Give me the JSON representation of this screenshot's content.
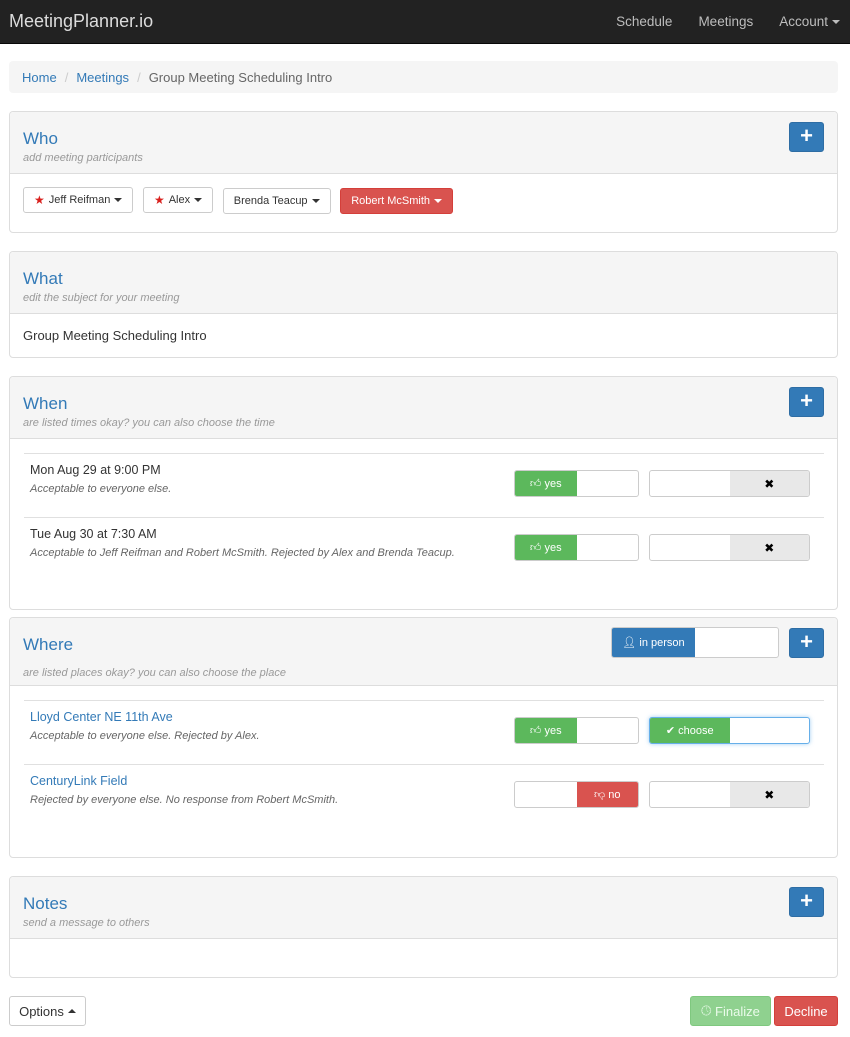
{
  "navbar": {
    "brand": "MeetingPlanner.io",
    "links": [
      "Schedule",
      "Meetings",
      "Account"
    ]
  },
  "breadcrumb": {
    "home": "Home",
    "meetings": "Meetings",
    "current": "Group Meeting Scheduling Intro"
  },
  "who": {
    "title": "Who",
    "subtitle": "add meeting participants",
    "participants": [
      "Jeff Reifman",
      "Alex",
      "Brenda Teacup",
      "Robert McSmith"
    ]
  },
  "what": {
    "title": "What",
    "subtitle": "edit the subject for your meeting",
    "subject": "Group Meeting Scheduling Intro"
  },
  "when": {
    "title": "When",
    "subtitle": "are listed times okay? you can also choose the time",
    "items": [
      {
        "time": "Mon Aug 29 at 9:00 PM",
        "status": "Acceptable to everyone else.",
        "vote": "yes"
      },
      {
        "time": "Tue Aug 30 at 7:30 AM",
        "status": "Acceptable to Jeff Reifman and Robert McSmith. Rejected by Alex and Brenda Teacup.",
        "vote": "yes"
      }
    ]
  },
  "where": {
    "title": "Where",
    "subtitle": "are listed places okay?  you can also choose the place",
    "in_person_label": "in person",
    "items": [
      {
        "place": "Lloyd Center NE 11th Ave",
        "status": "Acceptable to everyone else. Rejected by Alex.",
        "vote": "yes",
        "choose": "choose"
      },
      {
        "place": "CenturyLink Field",
        "status": "Rejected by everyone else. No response from Robert McSmith.",
        "vote": "no"
      }
    ]
  },
  "notes": {
    "title": "Notes",
    "subtitle": "send a message to others"
  },
  "labels": {
    "yes": "yes",
    "no": "no",
    "plus": "+",
    "close": "✖"
  },
  "footer": {
    "options": "Options",
    "finalize": "Finalize",
    "decline": "Decline"
  },
  "colors": {
    "primary": "#337ab7",
    "success": "#5cb85c",
    "danger": "#d9534f",
    "navbar": "#222222"
  }
}
